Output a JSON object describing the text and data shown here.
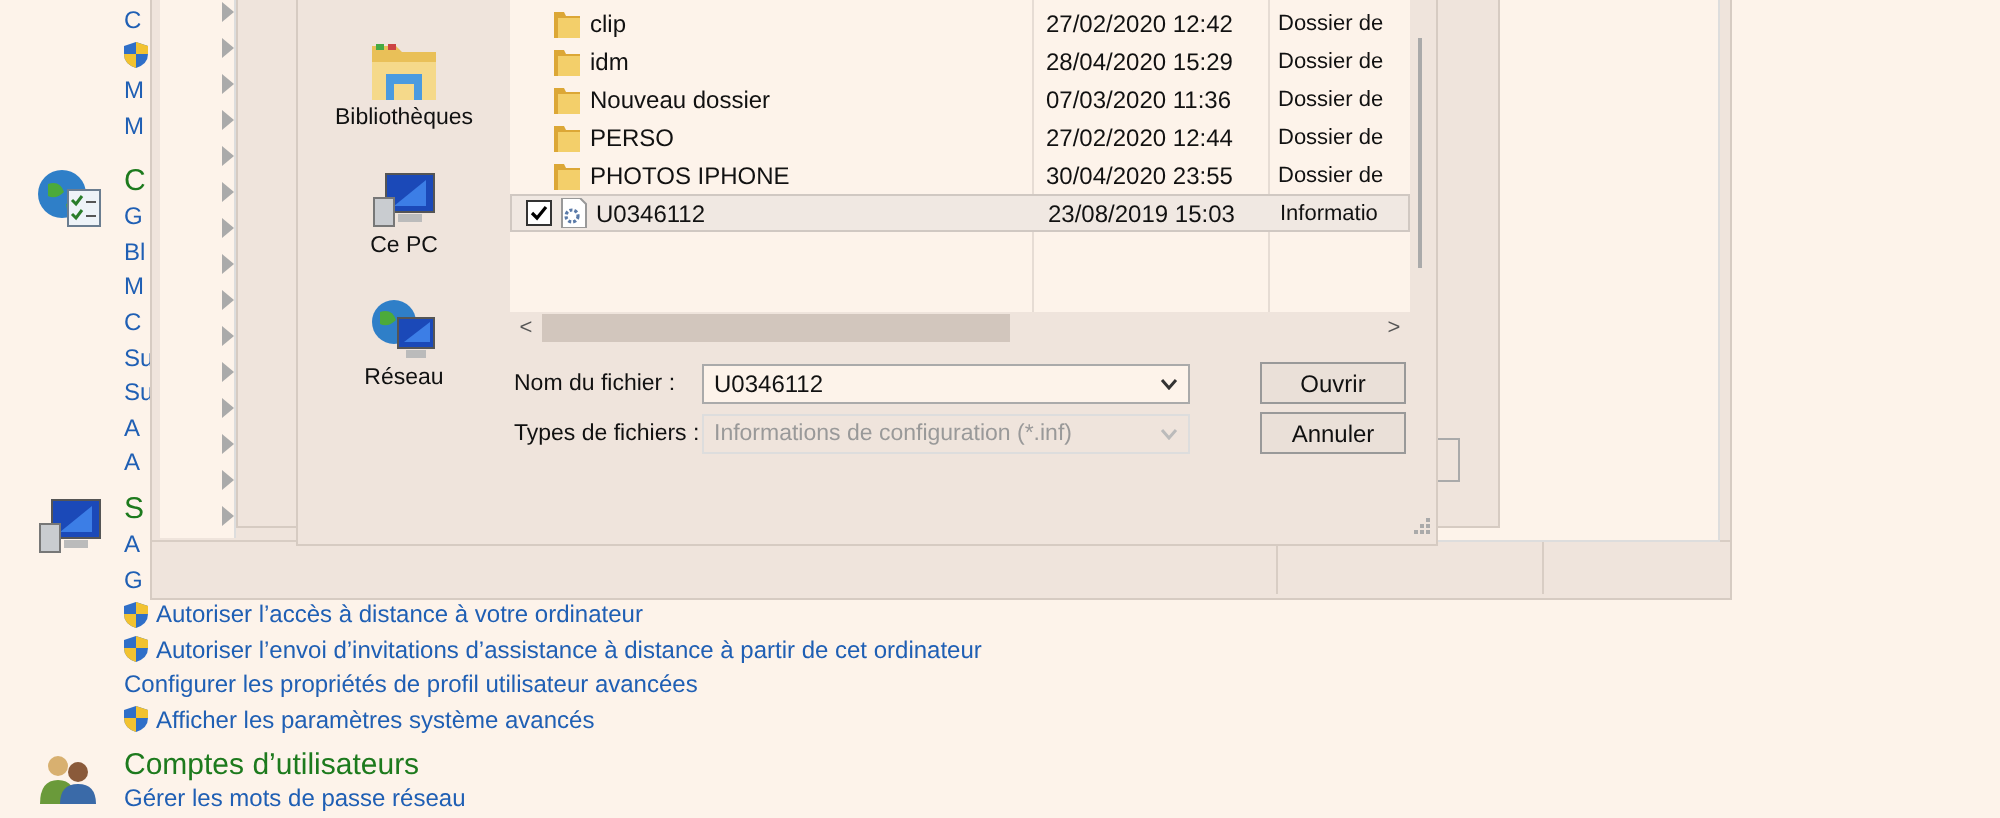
{
  "control_panel": {
    "sections": [
      {
        "items": [
          {
            "kind": "link",
            "text": "C"
          },
          {
            "kind": "shield"
          },
          {
            "kind": "link",
            "text": "M"
          },
          {
            "kind": "link",
            "text": "M"
          }
        ]
      },
      {
        "heading": "C",
        "items": [
          {
            "kind": "link",
            "text": "G"
          },
          {
            "kind": "link",
            "text": "Bl"
          },
          {
            "kind": "link",
            "text": "M"
          },
          {
            "kind": "link",
            "text": "C"
          },
          {
            "kind": "link",
            "text": "Su"
          },
          {
            "kind": "link",
            "text": "Su"
          },
          {
            "kind": "link",
            "text": "A"
          },
          {
            "kind": "link",
            "text": "A"
          }
        ]
      },
      {
        "heading": "S",
        "items": [
          {
            "kind": "link",
            "text": "A"
          },
          {
            "kind": "link",
            "text": "G"
          },
          {
            "kind": "shield-link",
            "text": "Autoriser l’accès à distance à votre ordinateur"
          },
          {
            "kind": "shield-link",
            "text": "Autoriser l’envoi d’invitations d’assistance à distance à partir de cet ordinateur"
          },
          {
            "kind": "link",
            "text": "Configurer les propriétés de profil utilisateur avancées"
          },
          {
            "kind": "shield-link",
            "text": "Afficher les paramètres système avancés"
          }
        ]
      },
      {
        "heading": "Comptes d’utilisateurs",
        "items": [
          {
            "kind": "link",
            "text": "Gérer les mots de passe réseau"
          }
        ]
      }
    ]
  },
  "open_dialog": {
    "places": [
      {
        "kind": "libraries",
        "label": "Bibliothèques"
      },
      {
        "kind": "pc",
        "label": "Ce PC"
      },
      {
        "kind": "network",
        "label": "Réseau"
      }
    ],
    "files": [
      {
        "kind": "folder",
        "name": "clip",
        "date": "27/02/2020 12:42",
        "type": "Dossier de",
        "checked": false,
        "selected": false
      },
      {
        "kind": "folder",
        "name": "idm",
        "date": "28/04/2020 15:29",
        "type": "Dossier de",
        "checked": false,
        "selected": false
      },
      {
        "kind": "folder",
        "name": "Nouveau dossier",
        "date": "07/03/2020 11:36",
        "type": "Dossier de",
        "checked": false,
        "selected": false
      },
      {
        "kind": "folder",
        "name": "PERSO",
        "date": "27/02/2020 12:44",
        "type": "Dossier de",
        "checked": false,
        "selected": false
      },
      {
        "kind": "folder",
        "name": "PHOTOS IPHONE",
        "date": "30/04/2020 23:55",
        "type": "Dossier de",
        "checked": false,
        "selected": false
      },
      {
        "kind": "file",
        "name": "U0346112",
        "date": "23/08/2019 15:03",
        "type": "Informatio",
        "checked": true,
        "selected": true
      }
    ],
    "filename_label": "Nom du fichier :",
    "filename_value": "U0346112",
    "filetype_label": "Types de fichiers :",
    "filetype_value": "Informations de configuration (*.inf)",
    "buttons": [
      "Ouvrir",
      "Annuler"
    ],
    "scroll_left": "<",
    "scroll_right": ">"
  }
}
